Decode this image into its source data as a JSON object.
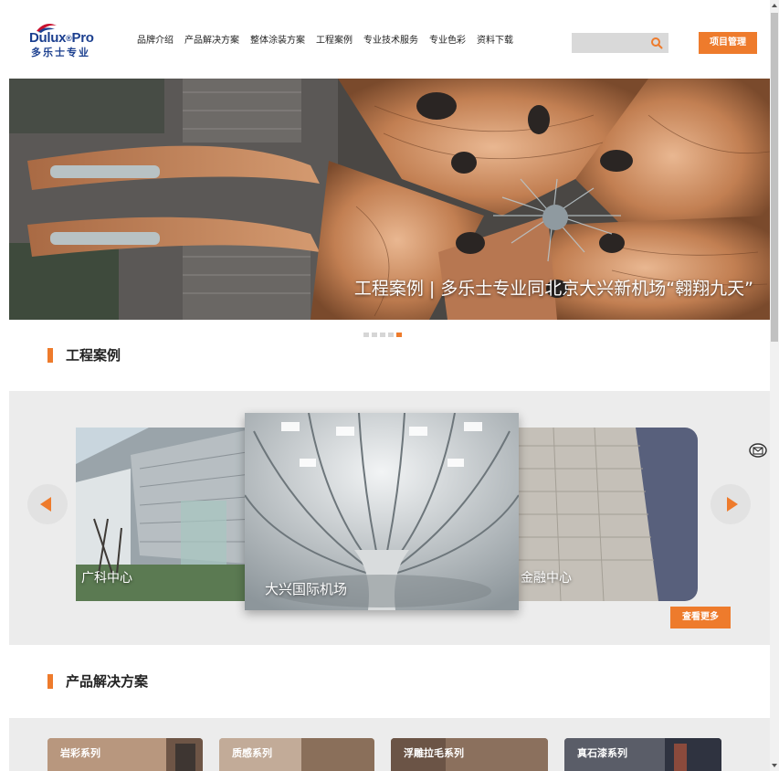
{
  "colors": {
    "accent": "#ee7b2c",
    "brand": "#1b3f8f",
    "band": "#ececec"
  },
  "logo": {
    "main": "Dulux",
    "pro": "Pro",
    "sub": "多乐士专业"
  },
  "nav": [
    "品牌介绍",
    "产品解决方案",
    "整体涂装方案",
    "工程案例",
    "专业技术服务",
    "专业色彩",
    "资料下载"
  ],
  "search": {
    "placeholder": "",
    "icon": "search-icon"
  },
  "header": {
    "project_button": "项目管理"
  },
  "hero": {
    "caption": "工程案例 | 多乐士专业同北京大兴新机场“翱翔九天”",
    "slides": 5,
    "active_slide": 5
  },
  "cases": {
    "title": "工程案例",
    "cards": [
      {
        "label": "广科中心"
      },
      {
        "label": "大兴国际机场"
      },
      {
        "label": "金融中心"
      }
    ],
    "more_button": "查看更多"
  },
  "products": {
    "title": "产品解决方案",
    "items": [
      {
        "label": "岩彩系列"
      },
      {
        "label": "质感系列"
      },
      {
        "label": "浮雕拉毛系列"
      },
      {
        "label": "真石漆系列"
      }
    ]
  }
}
